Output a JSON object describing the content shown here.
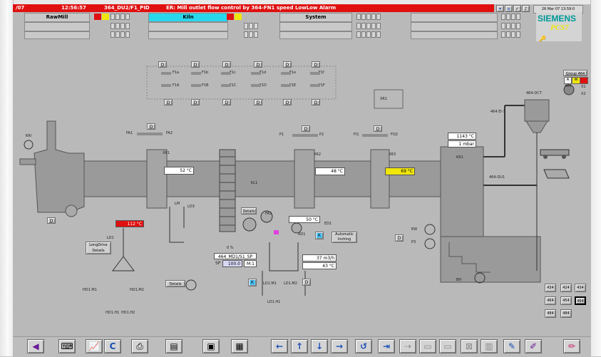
{
  "alarm": {
    "date": "/07",
    "time": "12:56:57",
    "tag": "364_DU2/F1_PID",
    "message": "ER: Mill outlet flow control by 364-FN1 speed LowLow Alarm"
  },
  "areas": {
    "raw_mill": "RawMill",
    "kiln": "Kiln",
    "system": "System"
  },
  "brand": {
    "name": "SIEMENS",
    "product": "PCS7"
  },
  "clock": "26 Mar 07 13:59:0",
  "group_panel": {
    "title": "Group 464",
    "a": "A",
    "w": "W",
    "x1": "X1",
    "x2": "X2",
    "n": "464"
  },
  "fans": [
    "F1a",
    "F1b",
    "F1c",
    "F1d",
    "F1e",
    "F1f"
  ],
  "fan_lower": [
    "F1A",
    "F1B",
    "F1C",
    "F1D",
    "F1E",
    "F1F"
  ],
  "labels": {
    "xr1_box": "XR1",
    "dct": "464-DCT",
    "el1": "464 El-1",
    "du1": "464-DU1",
    "kl1": "KL1",
    "xr1": "XR1",
    "xr2": "XR2",
    "xr3": "XR3",
    "kiln_inlet": "KRI",
    "bh": "BH",
    "mill": "MM",
    "fa1": "FA1",
    "fa2": "FA2",
    "p1": "P1",
    "p2": "P2",
    "p3": "P3",
    "fi": "FI1",
    "fo": "FO2",
    "ad1": "AD1",
    "ed1": "ED1",
    "ew": "EW",
    "lm": "LM",
    "ld1": "LD1",
    "ld3": "LD3",
    "hd1_m1": "HD1.M1",
    "hd1_m2": "HD1.M2",
    "hd1_h1": "HD1.H1",
    "hd1_h2": "HD1.H2",
    "ld1_m1": "LD1.M1",
    "ld1_m2": "LD1.M2",
    "ld1_h1": "LD1.H1",
    "kr1": "KR1",
    "fa3": "FA3"
  },
  "values": {
    "kiln_temp_1": "52 °C",
    "kiln_temp_2": "48 °C",
    "kiln_temp_3": "69 °C",
    "inlet_temp": "1143 °C",
    "inlet_pressure": "1 mbar",
    "mill_temp": "50 °C",
    "left_alarm_temp": "112 °C",
    "pct": "0 %",
    "pid_tag": "464_MD1/S1_SP",
    "sp_label": "SP",
    "sp_value": "100.0",
    "sp_mode": "M:1",
    "flow": "37 m3/h",
    "flow_temp": "43 °C"
  },
  "buttons": {
    "d": "D",
    "details": "Details",
    "long_drive": "LongDrive Details",
    "auto_inching": "Automatic Inching",
    "details2": "Details",
    "k": "K"
  },
  "group_buttons": [
    "434",
    "424",
    "434",
    "464",
    "454",
    "464",
    "484",
    "484"
  ],
  "toolbar_icons": [
    "arrow-left-icon",
    "keyboard-icon",
    "trend-icon",
    "console-icon",
    "print-icon",
    "report-icon",
    "window-icon",
    "window2-icon",
    "nav-left-icon",
    "nav-up-icon",
    "nav-down-icon",
    "nav-right-icon",
    "undo-icon",
    "split-icon",
    "merge-icon",
    "layout-icon",
    "layout2-icon",
    "close-window-icon",
    "save-icon",
    "pen-icon",
    "pen-cross-icon",
    "brush-icon"
  ],
  "colors": {
    "alarm": "#e01010",
    "kiln_header": "#29d7ec",
    "highlight": "#f0e60a",
    "status_blue": "#4fc3f7",
    "alarm_red": "#e01010"
  }
}
